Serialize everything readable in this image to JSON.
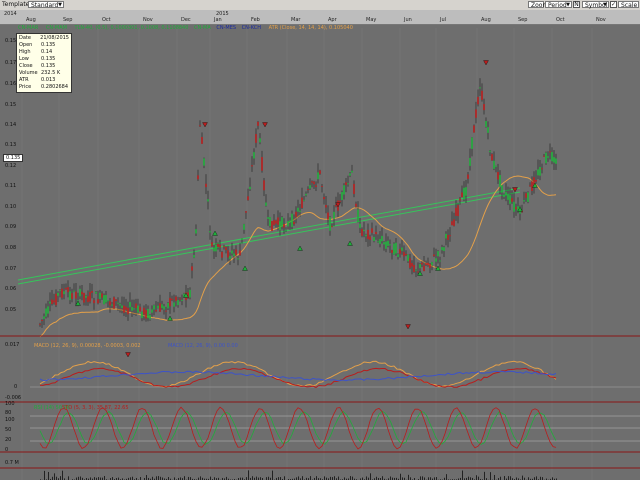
{
  "toolbar": {
    "template_label": "Template:",
    "template_value": "Standard",
    "zoom_label": "Zoom",
    "period_label": "Period",
    "n_label": "N",
    "symbol_label": "Symbol",
    "scale_label": "Scale",
    "check_mark": "✓"
  },
  "timeline": {
    "year_left": "2014",
    "year_mid": "2015",
    "months": [
      "Aug",
      "Sep",
      "Oct",
      "Nov",
      "Dec",
      "Jan",
      "Feb",
      "Mar",
      "Apr",
      "May",
      "Jun",
      "Jul",
      "Aug",
      "Sep",
      "Oct",
      "Nov"
    ]
  },
  "legend": {
    "ma1": "CN-MAR",
    "ma2": "CN-MAM",
    "trend": "TLN-40, (0.5), 0.1000301, 0.1008, 0.1108840",
    "cn1": "CN-MA",
    "cn2": "CN-MES",
    "cn3": "CN-KCH",
    "atr": "ATR (Close, 14, 14, 14), 0.105040"
  },
  "info_box": {
    "rows": [
      {
        "k": "Date",
        "v": "21/08/2015"
      },
      {
        "k": "Open",
        "v": "0.135"
      },
      {
        "k": "High",
        "v": "0.14"
      },
      {
        "k": "Low",
        "v": "0.135"
      },
      {
        "k": "Close",
        "v": "0.135"
      },
      {
        "k": "Volume",
        "v": "232.5 K"
      },
      {
        "k": "ATR",
        "v": "0.013"
      },
      {
        "k": "Price",
        "v": "0.2802684"
      }
    ]
  },
  "price_flag": "0.135",
  "price_axis": [
    "0.15",
    "0.17",
    "0.16",
    "0.15",
    "0.14",
    "0.13",
    "0.12",
    "0.11",
    "0.10",
    "0.09",
    "0.08",
    "0.07",
    "0.06",
    "0.05"
  ],
  "macd": {
    "label": "MACD (12, 26, 9), 0.00028, -0.0003, 0.002",
    "label2": "MACD (12, 26, 9), 0.00 0.00",
    "axis": [
      "0.017",
      "0",
      "-0.006"
    ]
  },
  "osc": {
    "label1": "RSI (14) 50.06",
    "label2": "STO (5, 3, 3), 35.87, 22.65",
    "axis": [
      "100",
      "80",
      "100",
      "50",
      "20",
      "0"
    ]
  },
  "volume": {
    "axis": "0.7 M"
  },
  "colors": {
    "bg": "#6e6e6e",
    "bull": "#1fae3a",
    "bear": "#b81d1d",
    "ma": "#e3a04a",
    "trend": "#35c55a"
  }
}
